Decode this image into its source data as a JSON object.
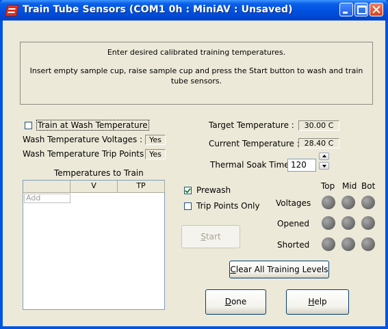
{
  "window": {
    "title": "Train Tube Sensors (COM1 0h : MiniAV : Unsaved)"
  },
  "info": {
    "line1": "Enter desired calibrated training temperatures.",
    "line2": "Insert empty sample cup, raise sample cup and press the Start button to wash and train tube sensors."
  },
  "left": {
    "train_at_wash_label": "Train at Wash Temperature",
    "train_at_wash_checked": false,
    "wash_voltages_label": "Wash Temperature Voltages :",
    "wash_voltages_value": "Yes",
    "wash_trip_label": "Wash Temperature Trip Points :",
    "wash_trip_value": "Yes",
    "temps_title": "Temperatures to Train",
    "columns": [
      "",
      "V",
      "TP"
    ],
    "add_placeholder": "Add"
  },
  "right": {
    "target_label": "Target Temperature :",
    "target_value": "30.00 C",
    "current_label": "Current Temperature :",
    "current_value": "28.40 C",
    "soak_label": "Thermal Soak Time (s) :",
    "soak_value": "120",
    "prewash_label": "Prewash",
    "prewash_checked": true,
    "trip_only_label": "Trip Points Only",
    "trip_only_checked": false,
    "led_headers": [
      "Top",
      "Mid",
      "Bot"
    ],
    "led_rows": [
      "Voltages",
      "Opened",
      "Shorted"
    ]
  },
  "buttons": {
    "start_first": "S",
    "start_rest": "tart",
    "clear_first": "C",
    "clear_rest": "lear All Training Levels",
    "done_first": "D",
    "done_rest": "one",
    "help_first": "H",
    "help_rest": "elp"
  },
  "colors": {
    "titlebar": "#0054e3",
    "window_bg": "#ece9d8",
    "led": "#7a7a7a",
    "close": "#d4401a"
  }
}
